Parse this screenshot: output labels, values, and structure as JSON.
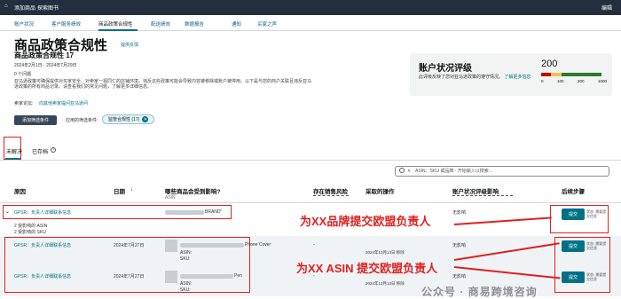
{
  "topbar": {
    "items": [
      "添加商品",
      "探索图书"
    ],
    "right": "编辑"
  },
  "nav": {
    "items": [
      "账户状况",
      "客户服务绩效",
      "商品政策合规性",
      "配送绩效",
      "数据报告",
      "通知",
      "买家之声"
    ]
  },
  "header": {
    "title": "商品政策合规性",
    "feedback": "提供反馈",
    "subtitle": "商品政策合规性 17",
    "date_range": "2024年2月1日 - 2024年7月29日",
    "flagged": "0 个问题",
    "description_1": "亚马逊政策可确保提供对买家安全、对卖家一视同仁的店铺环境。违反这些政策可能会导致内容被移除或账户被停用。以下是与您的商户关联且违反亚马逊政策的所有商品记录。请查看我们的常见问题，了解更多详细信息。",
    "forum": "卖家论坛:",
    "forum_link": "向其他卖家提问亚马逊问"
  },
  "filters": {
    "add_button": "添加筛选条件",
    "applied_label": "应用的筛选条件:",
    "chip": "监管合规性 (17)"
  },
  "health_panel": {
    "title": "账户状况评级",
    "desc": "此评级反映了您对亚马逊政策的遵守情况。",
    "link": "了解更多信息",
    "score": "200",
    "scale": [
      "0",
      "100",
      "200",
      "1000"
    ]
  },
  "tabs": {
    "unresolved": "未解决",
    "resolved": "已存档"
  },
  "search": {
    "placeholder": "ASIN、SKU 或品牌 - 开始输入以搜索..."
  },
  "table": {
    "headers": [
      "原因",
      "日期",
      "哪些商品会受到影响?",
      "存在销售风险",
      "采取的操作",
      "账户状况评级影响",
      "后续步骤"
    ],
    "asin_sub": "ASIN",
    "rows": [
      {
        "reason": "GPSR：负责人详细联系信息",
        "date": "",
        "product": "BRAND\"",
        "risk": "",
        "action": "",
        "impact": "无影响",
        "button": "提交",
        "status": "状态: 需要提交信息"
      },
      {
        "reason": "GPSR：负责人详细联系信息",
        "date": "2024年7月27日",
        "product": "Phone Cover",
        "risk": "-",
        "action": "2024年12月13日 移除",
        "impact": "无影响",
        "button": "提交",
        "status": "状态: 需要提交信息"
      },
      {
        "reason": "GPSR：负责人详细联系信息",
        "date": "2024年7月27日",
        "product": "Pen",
        "risk": "-",
        "action": "2024年12月13日 移除",
        "impact": "无影响",
        "button": "提交",
        "status": "状态: 需要提交信息"
      }
    ],
    "affected_asin": "2 受影响的 ASIN",
    "affected_sku": "2 受影响的 SKU",
    "asin_label": "ASIN:",
    "sku_label": "SKU:"
  },
  "annotations": {
    "brand": "为XX品牌提交欧盟负责人",
    "asin": "为XX ASIN 提交欧盟负责人",
    "watermark": "公众号 · 商易跨境咨询"
  }
}
